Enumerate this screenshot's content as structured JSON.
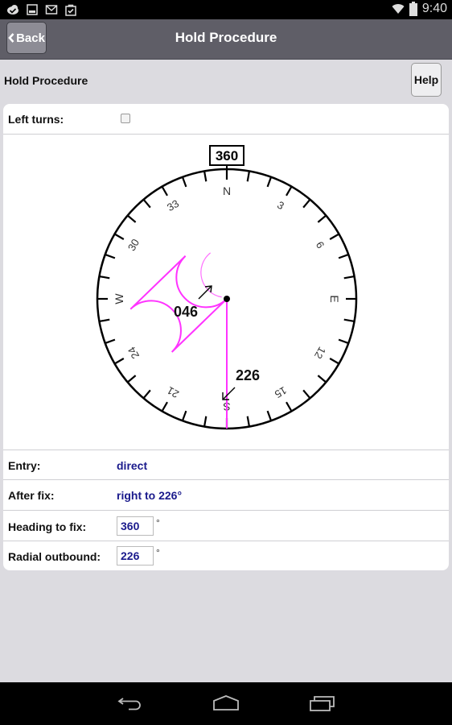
{
  "status_bar": {
    "time": "9:40",
    "left_icons": [
      "cloud-check-icon",
      "image-icon",
      "gmail-icon",
      "shopping-bag-check-icon"
    ],
    "right_icons": [
      "wifi-icon",
      "battery-icon"
    ]
  },
  "header": {
    "back_label": "Back",
    "title": "Hold Procedure"
  },
  "subheader": {
    "title": "Hold Procedure",
    "help_label": "Help"
  },
  "form": {
    "left_turns_label": "Left turns:",
    "left_turns_checked": false,
    "entry_label": "Entry:",
    "entry_value": "direct",
    "after_fix_label": "After fix:",
    "after_fix_value": "right to 226°",
    "heading_label": "Heading to fix:",
    "heading_value": "360",
    "radial_label": "Radial outbound:",
    "radial_value": "226",
    "degree_symbol": "°"
  },
  "compass": {
    "heading_box": "360",
    "heading_deg": 360,
    "radial_deg": 226,
    "inbound_label": "046",
    "outbound_label": "226",
    "cardinals": {
      "N": "N",
      "E": "E",
      "S": "S",
      "W": "W"
    },
    "numbers": [
      {
        "deg": 30,
        "text": "3"
      },
      {
        "deg": 60,
        "text": "6"
      },
      {
        "deg": 120,
        "text": "12"
      },
      {
        "deg": 150,
        "text": "15"
      },
      {
        "deg": 210,
        "text": "21"
      },
      {
        "deg": 240,
        "text": "24"
      },
      {
        "deg": 300,
        "text": "30"
      },
      {
        "deg": 330,
        "text": "33"
      }
    ],
    "pattern_color": "#ff33ff"
  },
  "nav_bar": {
    "icons": [
      "back-nav-icon",
      "home-nav-icon",
      "recent-apps-icon"
    ]
  }
}
